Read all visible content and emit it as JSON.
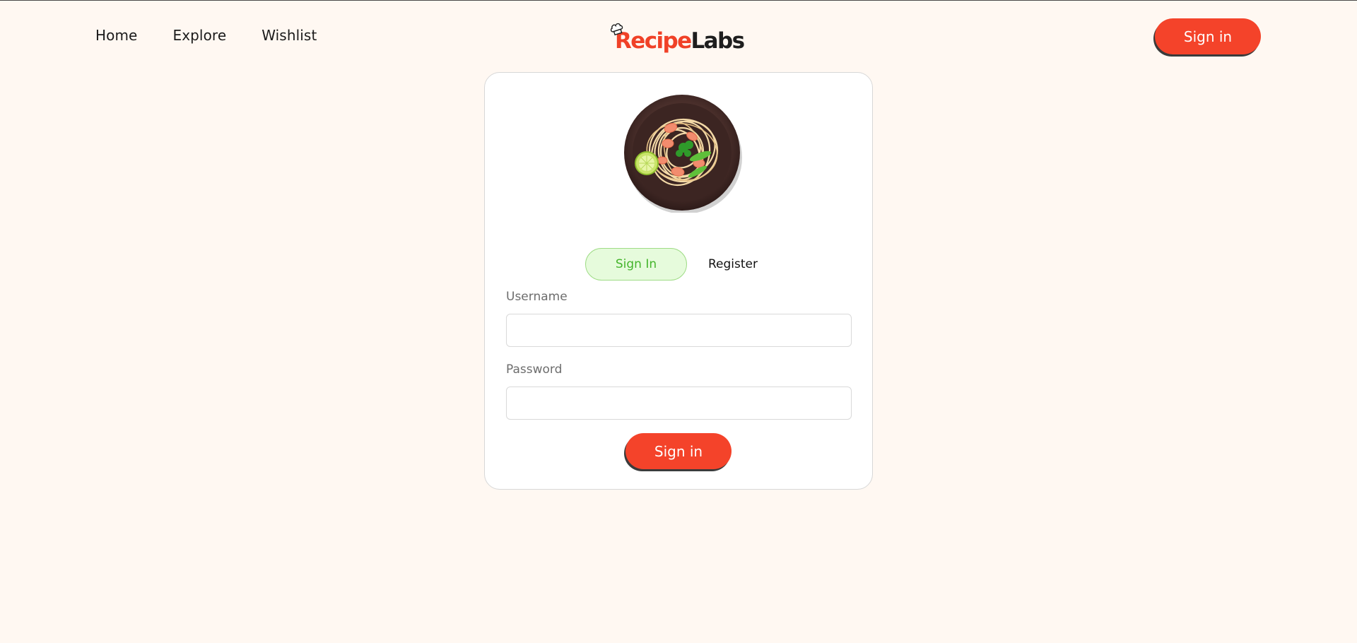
{
  "nav": {
    "links": [
      {
        "label": "Home"
      },
      {
        "label": "Explore"
      },
      {
        "label": "Wishlist"
      }
    ],
    "logo": {
      "part1": "Recipe",
      "part2": "Labs",
      "icon": "chef-hat-icon"
    },
    "signin_label": "Sign in"
  },
  "card": {
    "image_icon": "pasta-plate-icon",
    "tabs": [
      {
        "label": "Sign In",
        "active": true
      },
      {
        "label": "Register",
        "active": false
      }
    ],
    "fields": {
      "username_label": "Username",
      "username_value": "",
      "password_label": "Password",
      "password_value": ""
    },
    "submit_label": "Sign in"
  },
  "colors": {
    "background": "#fff8f2",
    "accent": "#f4432a",
    "active_tab_bg": "#e6fbdc",
    "active_tab_text": "#45b52c",
    "text": "#1b1b1b"
  }
}
